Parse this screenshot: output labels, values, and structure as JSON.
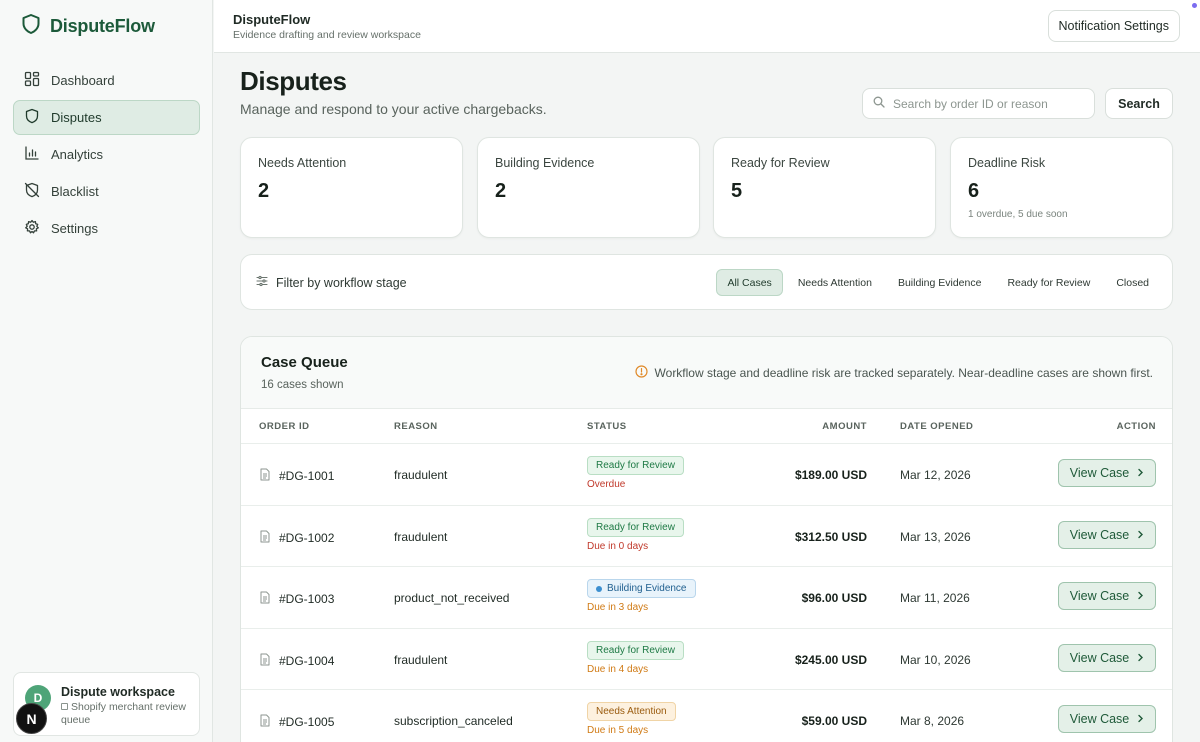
{
  "brand": {
    "name": "DisputeFlow"
  },
  "sidebar": {
    "items": [
      {
        "label": "Dashboard",
        "icon": "dashboard-icon",
        "active": false
      },
      {
        "label": "Disputes",
        "icon": "shield-icon",
        "active": true
      },
      {
        "label": "Analytics",
        "icon": "bar-chart-icon",
        "active": false
      },
      {
        "label": "Blacklist",
        "icon": "blocked-shield-icon",
        "active": false
      },
      {
        "label": "Settings",
        "icon": "gear-icon",
        "active": false
      }
    ],
    "workspace": {
      "avatar": "D",
      "title": "Dispute workspace",
      "subtitle": "Shopify merchant review queue"
    },
    "badge": "N"
  },
  "topbar": {
    "title": "DisputeFlow",
    "subtitle": "Evidence drafting and review workspace",
    "notification_button": "Notification Settings"
  },
  "page": {
    "title": "Disputes",
    "subtitle": "Manage and respond to your active chargebacks."
  },
  "search": {
    "placeholder": "Search by order ID or reason",
    "value": "",
    "button": "Search"
  },
  "stats": [
    {
      "label": "Needs Attention",
      "value": "2",
      "note": ""
    },
    {
      "label": "Building Evidence",
      "value": "2",
      "note": ""
    },
    {
      "label": "Ready for Review",
      "value": "5",
      "note": ""
    },
    {
      "label": "Deadline Risk",
      "value": "6",
      "note": "1 overdue, 5 due soon"
    }
  ],
  "filter": {
    "label": "Filter by workflow stage",
    "tabs": [
      {
        "label": "All Cases",
        "active": true
      },
      {
        "label": "Needs Attention",
        "active": false
      },
      {
        "label": "Building Evidence",
        "active": false
      },
      {
        "label": "Ready for Review",
        "active": false
      },
      {
        "label": "Closed",
        "active": false
      }
    ]
  },
  "queue": {
    "title": "Case Queue",
    "count": "16 cases shown",
    "notice": "Workflow stage and deadline risk are tracked separately. Near-deadline cases are shown first.",
    "columns": [
      "ORDER ID",
      "REASON",
      "STATUS",
      "AMOUNT",
      "DATE OPENED",
      "ACTION"
    ],
    "action_label": "View Case",
    "rows": [
      {
        "order": "#DG-1001",
        "reason": "fraudulent",
        "status": "Ready for Review",
        "status_kind": "ready",
        "due": "Overdue",
        "due_kind": "red",
        "amount": "$189.00 USD",
        "date": "Mar 12, 2026"
      },
      {
        "order": "#DG-1002",
        "reason": "fraudulent",
        "status": "Ready for Review",
        "status_kind": "ready",
        "due": "Due in 0 days",
        "due_kind": "red",
        "amount": "$312.50 USD",
        "date": "Mar 13, 2026"
      },
      {
        "order": "#DG-1003",
        "reason": "product_not_received",
        "status": "Building Evidence",
        "status_kind": "building",
        "due": "Due in 3 days",
        "due_kind": "orange",
        "amount": "$96.00 USD",
        "date": "Mar 11, 2026"
      },
      {
        "order": "#DG-1004",
        "reason": "fraudulent",
        "status": "Ready for Review",
        "status_kind": "ready",
        "due": "Due in 4 days",
        "due_kind": "orange",
        "amount": "$245.00 USD",
        "date": "Mar 10, 2026"
      },
      {
        "order": "#DG-1005",
        "reason": "subscription_canceled",
        "status": "Needs Attention",
        "status_kind": "attention",
        "due": "Due in 5 days",
        "due_kind": "orange",
        "amount": "$59.00 USD",
        "date": "Mar 8, 2026"
      }
    ]
  },
  "colors": {
    "brand": "#1c5a3a",
    "active_bg": "#dfece4",
    "ready_bg": "#e8f6ec",
    "ready_border": "#b9dec4",
    "ready_text": "#1e7a45",
    "building_bg": "#e8f3fb",
    "building_border": "#b9d6ec",
    "building_text": "#1f5f8f",
    "attention_bg": "#fdf1df",
    "attention_border": "#f0d4a6",
    "attention_text": "#9a5b0e",
    "due_red": "#c0392b",
    "due_orange": "#d07a14"
  }
}
